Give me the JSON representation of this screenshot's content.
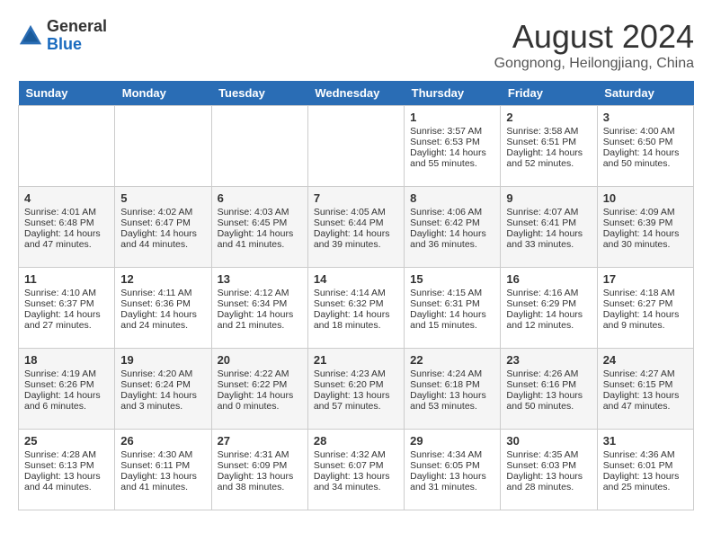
{
  "header": {
    "logo_general": "General",
    "logo_blue": "Blue",
    "month_year": "August 2024",
    "location": "Gongnong, Heilongjiang, China"
  },
  "days_of_week": [
    "Sunday",
    "Monday",
    "Tuesday",
    "Wednesday",
    "Thursday",
    "Friday",
    "Saturday"
  ],
  "weeks": [
    [
      {
        "day": "",
        "empty": true
      },
      {
        "day": "",
        "empty": true
      },
      {
        "day": "",
        "empty": true
      },
      {
        "day": "",
        "empty": true
      },
      {
        "day": "1",
        "sunrise": "Sunrise: 3:57 AM",
        "sunset": "Sunset: 6:53 PM",
        "daylight": "Daylight: 14 hours and 55 minutes."
      },
      {
        "day": "2",
        "sunrise": "Sunrise: 3:58 AM",
        "sunset": "Sunset: 6:51 PM",
        "daylight": "Daylight: 14 hours and 52 minutes."
      },
      {
        "day": "3",
        "sunrise": "Sunrise: 4:00 AM",
        "sunset": "Sunset: 6:50 PM",
        "daylight": "Daylight: 14 hours and 50 minutes."
      }
    ],
    [
      {
        "day": "4",
        "sunrise": "Sunrise: 4:01 AM",
        "sunset": "Sunset: 6:48 PM",
        "daylight": "Daylight: 14 hours and 47 minutes."
      },
      {
        "day": "5",
        "sunrise": "Sunrise: 4:02 AM",
        "sunset": "Sunset: 6:47 PM",
        "daylight": "Daylight: 14 hours and 44 minutes."
      },
      {
        "day": "6",
        "sunrise": "Sunrise: 4:03 AM",
        "sunset": "Sunset: 6:45 PM",
        "daylight": "Daylight: 14 hours and 41 minutes."
      },
      {
        "day": "7",
        "sunrise": "Sunrise: 4:05 AM",
        "sunset": "Sunset: 6:44 PM",
        "daylight": "Daylight: 14 hours and 39 minutes."
      },
      {
        "day": "8",
        "sunrise": "Sunrise: 4:06 AM",
        "sunset": "Sunset: 6:42 PM",
        "daylight": "Daylight: 14 hours and 36 minutes."
      },
      {
        "day": "9",
        "sunrise": "Sunrise: 4:07 AM",
        "sunset": "Sunset: 6:41 PM",
        "daylight": "Daylight: 14 hours and 33 minutes."
      },
      {
        "day": "10",
        "sunrise": "Sunrise: 4:09 AM",
        "sunset": "Sunset: 6:39 PM",
        "daylight": "Daylight: 14 hours and 30 minutes."
      }
    ],
    [
      {
        "day": "11",
        "sunrise": "Sunrise: 4:10 AM",
        "sunset": "Sunset: 6:37 PM",
        "daylight": "Daylight: 14 hours and 27 minutes."
      },
      {
        "day": "12",
        "sunrise": "Sunrise: 4:11 AM",
        "sunset": "Sunset: 6:36 PM",
        "daylight": "Daylight: 14 hours and 24 minutes."
      },
      {
        "day": "13",
        "sunrise": "Sunrise: 4:12 AM",
        "sunset": "Sunset: 6:34 PM",
        "daylight": "Daylight: 14 hours and 21 minutes."
      },
      {
        "day": "14",
        "sunrise": "Sunrise: 4:14 AM",
        "sunset": "Sunset: 6:32 PM",
        "daylight": "Daylight: 14 hours and 18 minutes."
      },
      {
        "day": "15",
        "sunrise": "Sunrise: 4:15 AM",
        "sunset": "Sunset: 6:31 PM",
        "daylight": "Daylight: 14 hours and 15 minutes."
      },
      {
        "day": "16",
        "sunrise": "Sunrise: 4:16 AM",
        "sunset": "Sunset: 6:29 PM",
        "daylight": "Daylight: 14 hours and 12 minutes."
      },
      {
        "day": "17",
        "sunrise": "Sunrise: 4:18 AM",
        "sunset": "Sunset: 6:27 PM",
        "daylight": "Daylight: 14 hours and 9 minutes."
      }
    ],
    [
      {
        "day": "18",
        "sunrise": "Sunrise: 4:19 AM",
        "sunset": "Sunset: 6:26 PM",
        "daylight": "Daylight: 14 hours and 6 minutes."
      },
      {
        "day": "19",
        "sunrise": "Sunrise: 4:20 AM",
        "sunset": "Sunset: 6:24 PM",
        "daylight": "Daylight: 14 hours and 3 minutes."
      },
      {
        "day": "20",
        "sunrise": "Sunrise: 4:22 AM",
        "sunset": "Sunset: 6:22 PM",
        "daylight": "Daylight: 14 hours and 0 minutes."
      },
      {
        "day": "21",
        "sunrise": "Sunrise: 4:23 AM",
        "sunset": "Sunset: 6:20 PM",
        "daylight": "Daylight: 13 hours and 57 minutes."
      },
      {
        "day": "22",
        "sunrise": "Sunrise: 4:24 AM",
        "sunset": "Sunset: 6:18 PM",
        "daylight": "Daylight: 13 hours and 53 minutes."
      },
      {
        "day": "23",
        "sunrise": "Sunrise: 4:26 AM",
        "sunset": "Sunset: 6:16 PM",
        "daylight": "Daylight: 13 hours and 50 minutes."
      },
      {
        "day": "24",
        "sunrise": "Sunrise: 4:27 AM",
        "sunset": "Sunset: 6:15 PM",
        "daylight": "Daylight: 13 hours and 47 minutes."
      }
    ],
    [
      {
        "day": "25",
        "sunrise": "Sunrise: 4:28 AM",
        "sunset": "Sunset: 6:13 PM",
        "daylight": "Daylight: 13 hours and 44 minutes."
      },
      {
        "day": "26",
        "sunrise": "Sunrise: 4:30 AM",
        "sunset": "Sunset: 6:11 PM",
        "daylight": "Daylight: 13 hours and 41 minutes."
      },
      {
        "day": "27",
        "sunrise": "Sunrise: 4:31 AM",
        "sunset": "Sunset: 6:09 PM",
        "daylight": "Daylight: 13 hours and 38 minutes."
      },
      {
        "day": "28",
        "sunrise": "Sunrise: 4:32 AM",
        "sunset": "Sunset: 6:07 PM",
        "daylight": "Daylight: 13 hours and 34 minutes."
      },
      {
        "day": "29",
        "sunrise": "Sunrise: 4:34 AM",
        "sunset": "Sunset: 6:05 PM",
        "daylight": "Daylight: 13 hours and 31 minutes."
      },
      {
        "day": "30",
        "sunrise": "Sunrise: 4:35 AM",
        "sunset": "Sunset: 6:03 PM",
        "daylight": "Daylight: 13 hours and 28 minutes."
      },
      {
        "day": "31",
        "sunrise": "Sunrise: 4:36 AM",
        "sunset": "Sunset: 6:01 PM",
        "daylight": "Daylight: 13 hours and 25 minutes."
      }
    ]
  ]
}
